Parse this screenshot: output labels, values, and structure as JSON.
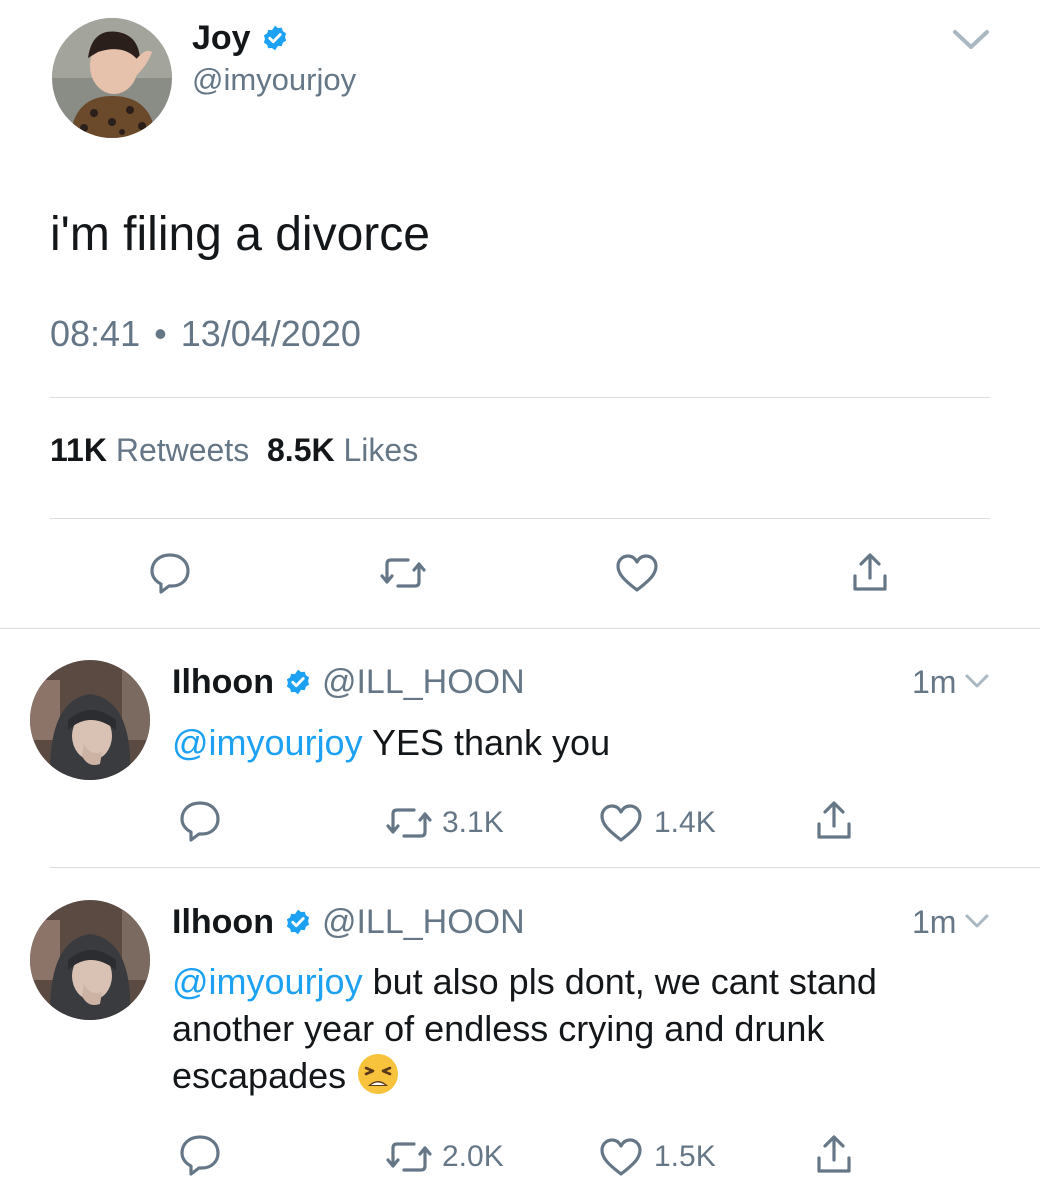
{
  "main_tweet": {
    "name": "Joy",
    "handle": "@imyourjoy",
    "text": "i'm filing a divorce",
    "time": "08:41",
    "separator": "•",
    "date": "13/04/2020",
    "retweets_count": "11K",
    "retweets_label": "Retweets",
    "likes_count": "8.5K",
    "likes_label": "Likes"
  },
  "replies": [
    {
      "name": "Ilhoon",
      "handle": "@ILL_HOON",
      "time": "1m",
      "mention": "@imyourjoy",
      "text": " YES thank you",
      "retweets": "3.1K",
      "likes": "1.4K"
    },
    {
      "name": "Ilhoon",
      "handle": "@ILL_HOON",
      "time": "1m",
      "mention": "@imyourjoy",
      "text": " but also pls dont, we cant stand another year of endless crying and drunk escapades",
      "emoji": "😫",
      "retweets": "2.0K",
      "likes": "1.5K"
    }
  ],
  "colors": {
    "accent": "#1da1f2",
    "secondary_text": "#657786",
    "divider": "#d9dde1"
  },
  "icons": [
    "verified-badge-icon",
    "chevron-down-icon",
    "reply-icon",
    "retweet-icon",
    "like-icon",
    "share-icon"
  ]
}
